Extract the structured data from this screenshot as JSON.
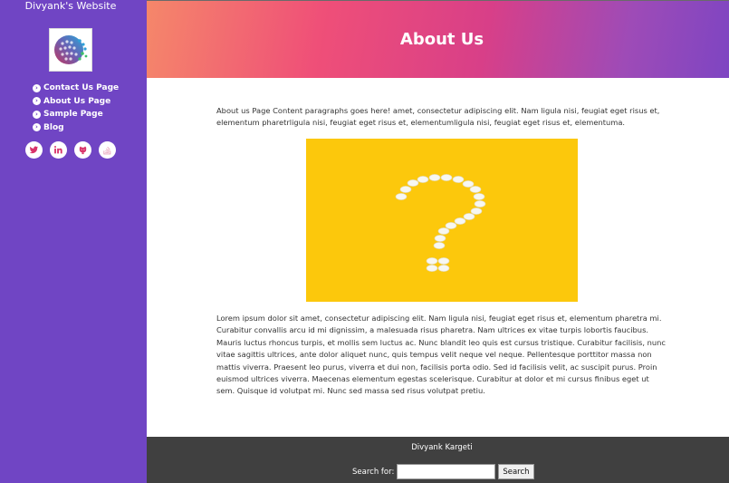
{
  "site": {
    "title": "Divyank's Website"
  },
  "sidebar": {
    "nav": [
      {
        "label": "Contact Us Page",
        "icon": "chevron-right-circle-icon"
      },
      {
        "label": "About Us Page",
        "icon": "chevron-right-circle-icon"
      },
      {
        "label": "Sample Page",
        "icon": "chevron-right-circle-icon"
      },
      {
        "label": "Blog",
        "icon": "chevron-right-circle-icon"
      }
    ],
    "social": [
      "twitter-icon",
      "linkedin-icon",
      "github-icon",
      "stackoverflow-icon"
    ]
  },
  "colors": {
    "sidebar": "#7045c4",
    "accent": "#e8336e",
    "footer": "#404040",
    "image_bg": "#fcc80c"
  },
  "header": {
    "title": "About Us"
  },
  "main": {
    "intro": "About us Page Content paragraphs goes here! amet, consectetur adipiscing elit. Nam ligula nisi, feugiat eget risus et, elementum pharetrligula nisi, feugiat eget risus et, elementumligula nisi, feugiat eget risus et, elementuma.",
    "body": "Lorem ipsum dolor sit amet, consectetur adipiscing elit. Nam ligula nisi, feugiat eget risus et, elementum pharetra mi. Curabitur convallis arcu id mi dignissim, a malesuada risus pharetra. Nam ultrices ex vitae turpis lobortis faucibus. Mauris luctus rhoncus turpis, et mollis sem luctus ac. Nunc blandit leo quis est cursus tristique. Curabitur facilisis, nunc vitae sagittis ultrices, ante dolor aliquet nunc, quis tempus velit neque vel neque. Pellentesque porttitor massa non mattis viverra. Praesent leo purus, viverra et dui non, facilisis porta odio. Sed id facilisis velit, ac suscipit purus. Proin euismod ultrices viverra. Maecenas elementum egestas scelerisque. Curabitur at dolor et mi cursus finibus eget ut sem. Quisque id volutpat mi. Nunc sed massa sed risus volutpat pretiu."
  },
  "footer": {
    "name": "Divyank Kargeti",
    "search_label": "Search for:",
    "search_value": "",
    "search_button": "Search"
  }
}
